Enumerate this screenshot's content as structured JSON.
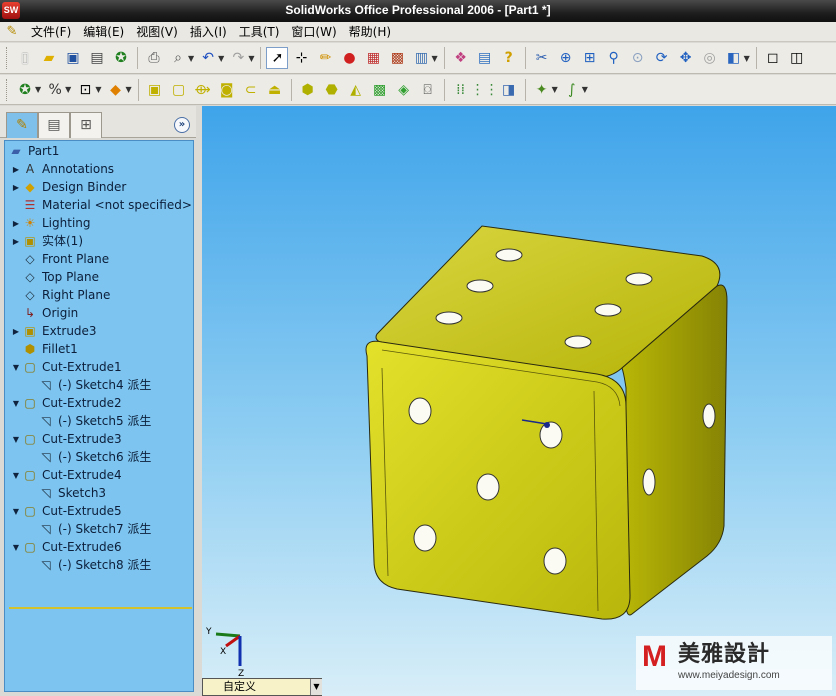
{
  "window": {
    "title": "SolidWorks Office Professional 2006 - [Part1 *]",
    "logo_text": "SW"
  },
  "menu": {
    "items": [
      "文件(F)",
      "编辑(E)",
      "视图(V)",
      "插入(I)",
      "工具(T)",
      "窗口(W)",
      "帮助(H)"
    ]
  },
  "feature_tree": {
    "root": "Part1",
    "items": [
      {
        "label": "Annotations",
        "icon": "annotations-icon",
        "expand": "collapsed",
        "indent": 0
      },
      {
        "label": "Design Binder",
        "icon": "design-binder-icon",
        "expand": "collapsed",
        "indent": 0
      },
      {
        "label": "Material <not specified>",
        "icon": "material-icon",
        "expand": "none",
        "indent": 0
      },
      {
        "label": "Lighting",
        "icon": "lighting-icon",
        "expand": "collapsed",
        "indent": 0
      },
      {
        "label": "实体(1)",
        "icon": "solid-bodies-icon",
        "expand": "collapsed",
        "indent": 0
      },
      {
        "label": "Front Plane",
        "icon": "plane-icon",
        "expand": "none",
        "indent": 0
      },
      {
        "label": "Top Plane",
        "icon": "plane-icon",
        "expand": "none",
        "indent": 0
      },
      {
        "label": "Right Plane",
        "icon": "plane-icon",
        "expand": "none",
        "indent": 0
      },
      {
        "label": "Origin",
        "icon": "origin-icon",
        "expand": "none",
        "indent": 0
      },
      {
        "label": "Extrude3",
        "icon": "extrude-icon",
        "expand": "collapsed",
        "indent": 0
      },
      {
        "label": "Fillet1",
        "icon": "fillet-icon",
        "expand": "none",
        "indent": 0
      },
      {
        "label": "Cut-Extrude1",
        "icon": "cut-extrude-icon",
        "expand": "expanded",
        "indent": 0
      },
      {
        "label": "(-) Sketch4 派生",
        "icon": "sketch-icon",
        "expand": "none",
        "indent": 1
      },
      {
        "label": "Cut-Extrude2",
        "icon": "cut-extrude-icon",
        "expand": "expanded",
        "indent": 0
      },
      {
        "label": "(-) Sketch5 派生",
        "icon": "sketch-icon",
        "expand": "none",
        "indent": 1
      },
      {
        "label": "Cut-Extrude3",
        "icon": "cut-extrude-icon",
        "expand": "expanded",
        "indent": 0
      },
      {
        "label": "(-) Sketch6 派生",
        "icon": "sketch-icon",
        "expand": "none",
        "indent": 1
      },
      {
        "label": "Cut-Extrude4",
        "icon": "cut-extrude-icon",
        "expand": "expanded",
        "indent": 0
      },
      {
        "label": "Sketch3",
        "icon": "sketch-icon",
        "expand": "none",
        "indent": 1
      },
      {
        "label": "Cut-Extrude5",
        "icon": "cut-extrude-icon",
        "expand": "expanded",
        "indent": 0
      },
      {
        "label": "(-) Sketch7 派生",
        "icon": "sketch-icon",
        "expand": "none",
        "indent": 1
      },
      {
        "label": "Cut-Extrude6",
        "icon": "cut-extrude-icon",
        "expand": "expanded",
        "indent": 0
      },
      {
        "label": "(-) Sketch8 派生",
        "icon": "sketch-icon",
        "expand": "none",
        "indent": 1
      }
    ]
  },
  "viewport": {
    "view_orientation": "自定义",
    "triad": {
      "x": "X",
      "y": "Y",
      "z": "Z"
    }
  },
  "watermark": {
    "logo": "M",
    "name": "美雅設計",
    "url": "www.meiyadesign.com"
  },
  "colors": {
    "model_face": "#cfcd0f",
    "tree_background": "#7dc5f0",
    "viewport_top": "#3fa4ea"
  }
}
